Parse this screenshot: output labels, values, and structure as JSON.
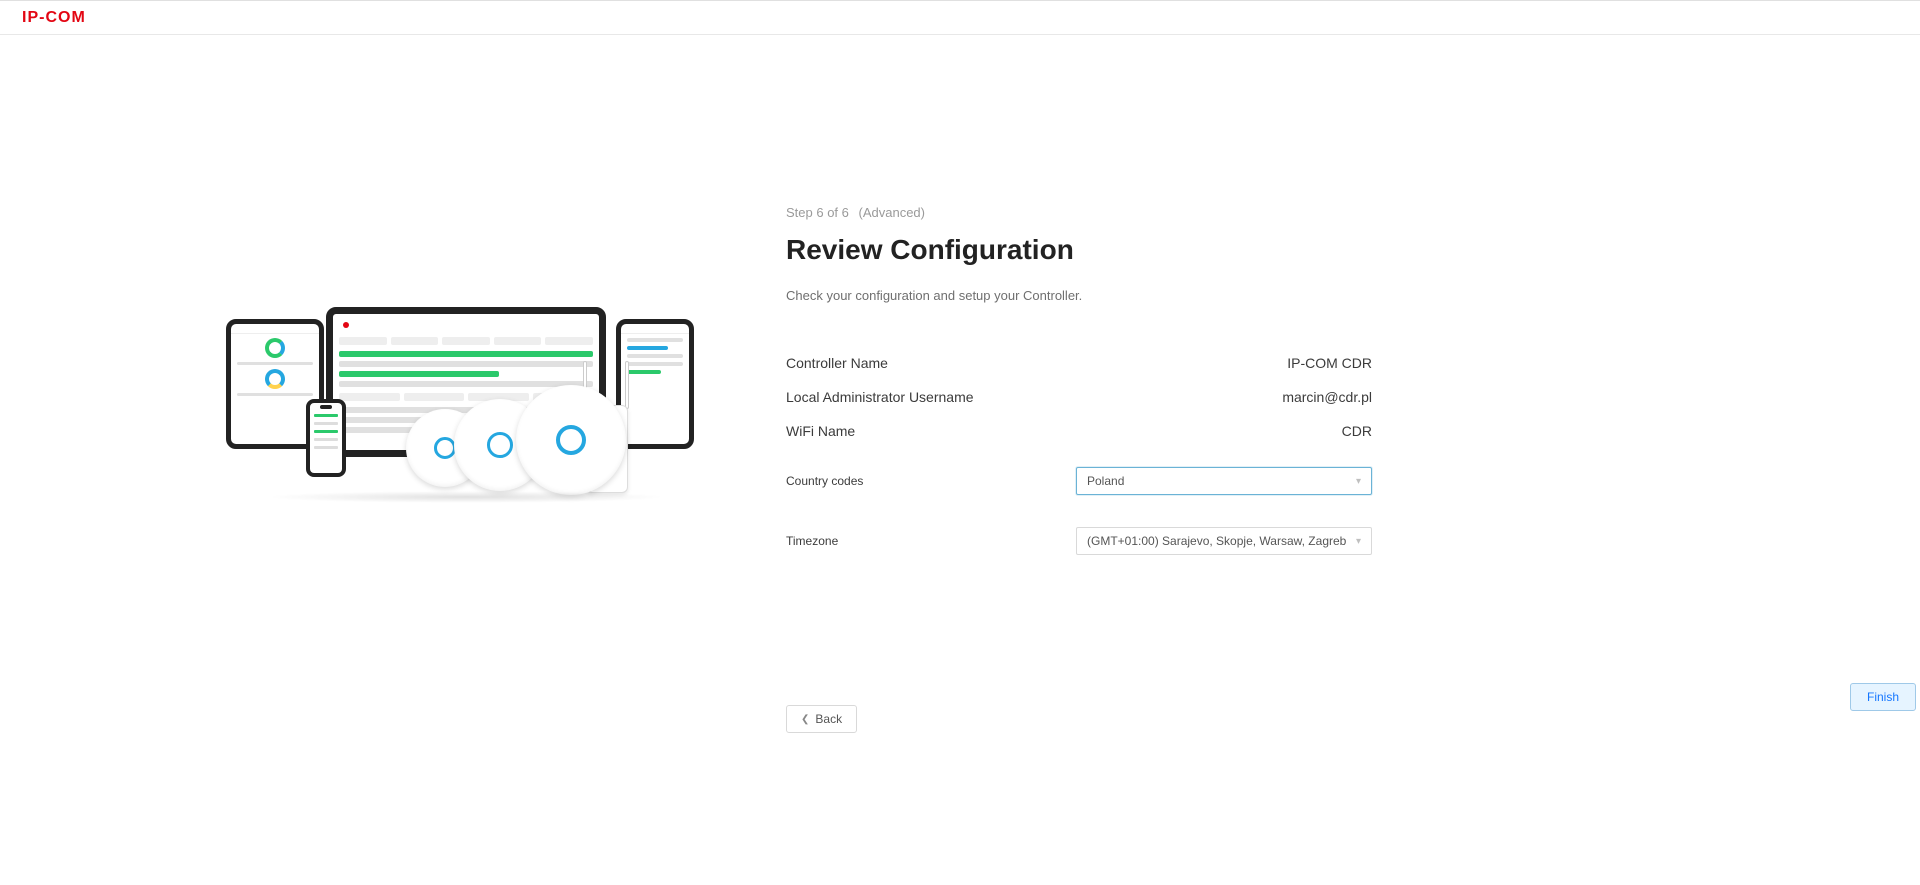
{
  "brand": "IP-COM",
  "step_line": "Step 6 of 6",
  "step_advanced": "(Advanced)",
  "title": "Review Configuration",
  "subtitle": "Check your configuration and setup your Controller.",
  "rows": {
    "controller_name_label": "Controller Name",
    "controller_name_value": "IP-COM CDR",
    "admin_label": "Local Administrator Username",
    "admin_value": "marcin@cdr.pl",
    "wifi_label": "WiFi Name",
    "wifi_value": "CDR"
  },
  "form": {
    "country_label": "Country codes",
    "country_value": "Poland",
    "timezone_label": "Timezone",
    "timezone_value": "(GMT+01:00) Sarajevo, Skopje, Warsaw, Zagreb"
  },
  "buttons": {
    "back": "Back",
    "finish": "Finish"
  }
}
